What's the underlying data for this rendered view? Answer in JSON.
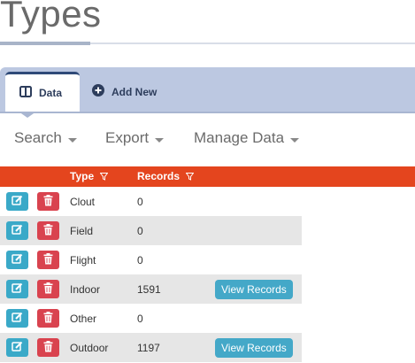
{
  "page": {
    "title": "Types"
  },
  "tabs": [
    {
      "label": "Data",
      "icon": "table-icon",
      "active": true
    },
    {
      "label": "Add New",
      "icon": "plus-circle-icon",
      "active": false
    }
  ],
  "menu": {
    "search": "Search",
    "export": "Export",
    "manage": "Manage Data"
  },
  "table": {
    "headers": {
      "type": "Type",
      "records": "Records"
    },
    "rows": [
      {
        "type": "Clout",
        "records": "0",
        "action": ""
      },
      {
        "type": "Field",
        "records": "0",
        "action": ""
      },
      {
        "type": "Flight",
        "records": "0",
        "action": ""
      },
      {
        "type": "Indoor",
        "records": "1591",
        "action": "View Records"
      },
      {
        "type": "Other",
        "records": "0",
        "action": ""
      },
      {
        "type": "Outdoor",
        "records": "1197",
        "action": "View Records"
      }
    ]
  },
  "colors": {
    "header": "#e4451e",
    "tabbar": "#bcc8e1",
    "edit": "#3aa9c8",
    "delete": "#d9434f",
    "view": "#44a8c8"
  }
}
